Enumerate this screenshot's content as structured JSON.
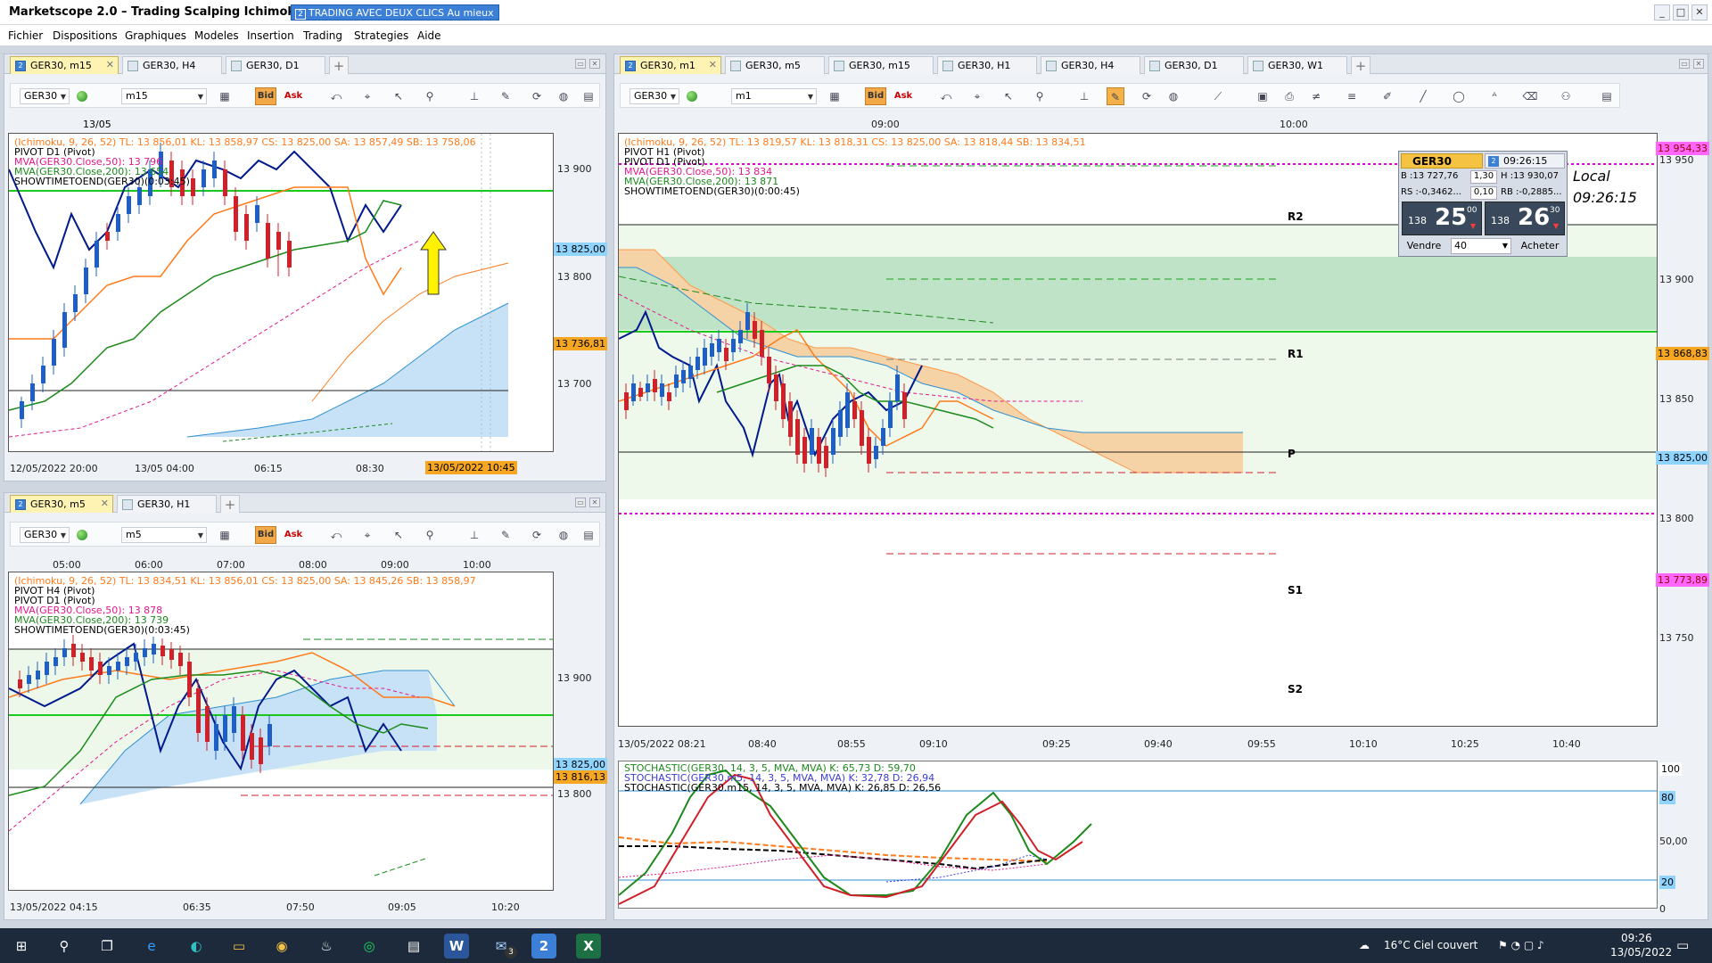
{
  "app": {
    "title": "Marketscope 2.0 – Trading Scalping Ichimoku",
    "badge_num": "2",
    "badge": "TRADING AVEC DEUX CLICS Au mieux",
    "win_min": "_",
    "win_max": "□",
    "win_close": "✕"
  },
  "menu": [
    "Fichier",
    "Dispositions",
    "Graphiques",
    "Modeles",
    "Insertion",
    "Trading",
    "Strategies",
    "Aide"
  ],
  "colors": {
    "accent": "#3b7fd6",
    "bid": "#f2a94a",
    "up": "#1e5fc7",
    "down": "#d0202a",
    "kijun": "#ff7a1a",
    "sma200": "#1b8a1b",
    "sma50": "#e0188c",
    "cloud_bear": "#f5c98e",
    "cloud_bull": "#c7e2f7",
    "pivot_green": "#19c91c",
    "magenta": "#e000e0"
  },
  "icons": [
    "bar-chart-icon",
    "bid-button",
    "ask-button",
    "zoom-icon",
    "crosshair-icon",
    "cursor-icon",
    "pointer-icon",
    "magnifier-icon",
    "period-icon",
    "indicators-icon",
    "refresh-icon",
    "globe-icon"
  ],
  "top_left": {
    "tabs": [
      {
        "label": "GER30, m15",
        "active": true
      },
      {
        "label": "GER30, H4"
      },
      {
        "label": "GER30, D1"
      }
    ],
    "symbol": "GER30",
    "timeframe": "m15",
    "bid": "Bid",
    "ask": "Ask",
    "legend": [
      "(Ichimoku, 9, 26, 52)  TL: 13 856,01  KL: 13 858,97  CS: 13 825,00  SA: 13 857,49  SB: 13 758,06",
      "PIVOT D1 (Pivot)",
      "MVA(GER30.Close,50): 13 796",
      "MVA(GER30.Close,200): 13 654",
      "SHOWTIMETOEND(GER30)(0:03:45)"
    ],
    "date_top": "13/05",
    "y_labels": [
      "13 900",
      "13 800",
      "13 700"
    ],
    "y_tags": [
      "13 825,00",
      "13 736,81"
    ],
    "x_labels": [
      "12/05/2022 20:00",
      "13/05 04:00",
      "06:15",
      "08:30"
    ],
    "x_tag": "13/05/2022 10:45"
  },
  "bottom_left": {
    "tabs": [
      {
        "label": "GER30, m5",
        "active": true
      },
      {
        "label": "GER30, H1"
      }
    ],
    "symbol": "GER30",
    "timeframe": "m5",
    "bid": "Bid",
    "ask": "Ask",
    "legend": [
      "(Ichimoku, 9, 26, 52)  TL: 13 834,51  KL: 13 856,01  CS: 13 825,00  SA: 13 845,26  SB: 13 858,97",
      "PIVOT H4 (Pivot)",
      "PIVOT D1 (Pivot)",
      "MVA(GER30.Close,50): 13 878",
      "MVA(GER30.Close,200): 13 739",
      "SHOWTIMETOEND(GER30)(0:03:45)"
    ],
    "x_top": [
      "05:00",
      "06:00",
      "07:00",
      "08:00",
      "09:00",
      "10:00"
    ],
    "y_labels": [
      "13 900",
      "13 800"
    ],
    "y_tags": [
      "13 825,00",
      "13 816,13"
    ],
    "x_labels": [
      "13/05/2022 04:15",
      "06:35",
      "07:50",
      "09:05",
      "10:20"
    ]
  },
  "main": {
    "tabs": [
      {
        "label": "GER30, m1",
        "active": true
      },
      {
        "label": "GER30, m5"
      },
      {
        "label": "GER30, m15"
      },
      {
        "label": "GER30, H1"
      },
      {
        "label": "GER30, H4"
      },
      {
        "label": "GER30, D1"
      },
      {
        "label": "GER30, W1"
      }
    ],
    "symbol": "GER30",
    "timeframe": "m1",
    "bid": "Bid",
    "ask": "Ask",
    "legend": [
      "(Ichimoku, 9, 26, 52)  TL: 13 819,57  KL: 13 818,31  CS: 13 825,00  SA: 13 818,44  SB: 13 834,51",
      "PIVOT H1 (Pivot)",
      "PIVOT D1 (Pivot)",
      "MVA(GER30.Close,50): 13 834",
      "MVA(GER30.Close,200): 13 871",
      "SHOWTIMETOEND(GER30)(0:00:45)"
    ],
    "x_top": [
      "09:00",
      "10:00"
    ],
    "pivots": [
      "R2",
      "R1",
      "P",
      "S1",
      "S2"
    ],
    "y_labels": [
      "13 950",
      "13 900",
      "13 850",
      "13 800",
      "13 750"
    ],
    "y_tags": [
      "13 954,33",
      "13 868,83",
      "13 825,00",
      "13 773,89"
    ],
    "x_labels": [
      "13/05/2022 08:21",
      "08:40",
      "08:55",
      "09:10",
      "09:25",
      "09:40",
      "09:55",
      "10:10",
      "10:25",
      "10:40"
    ],
    "stoch_legend": [
      "STOCHASTIC(GER30, 14, 3, 5, MVA, MVA)  K: 65,73  D: 59,70",
      "STOCHASTIC(GER30.m5, 14, 3, 5, MVA, MVA)  K: 32,78  D: 26,94",
      "STOCHASTIC(GER30.m15, 14, 3, 5, MVA, MVA)  K: 26,85  D: 26,56"
    ],
    "stoch_y": [
      "100",
      "80",
      "50,00",
      "20",
      "0"
    ]
  },
  "ticket": {
    "symbol": "GER30",
    "num": "2",
    "time": "09:26:15",
    "b": "B :13 727,76",
    "spread": "1,30",
    "h": "H :13 930,07",
    "rs": "RS :-0,3462...",
    "pips": "0,10",
    "rb": "RB :-0,2885...",
    "sell_big": "138",
    "sell": "25",
    "sell_sup": "00",
    "buy_big": "138",
    "buy": "26",
    "buy_sup": "30",
    "sell_label": "Vendre",
    "qty": "40",
    "buy_label": "Acheter",
    "local": "Local",
    "local_time": "09:26:15"
  },
  "taskbar": {
    "weather": "16°C  Ciel couvert",
    "time": "09:26",
    "date": "13/05/2022",
    "mail_count": "3"
  }
}
